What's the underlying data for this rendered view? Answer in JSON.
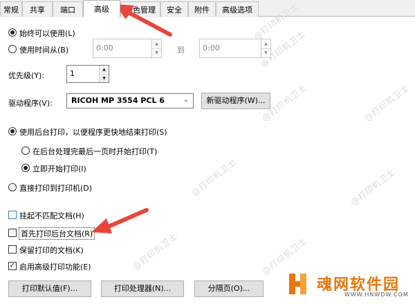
{
  "tabs": [
    "常规",
    "共享",
    "端口",
    "高级",
    "颜色管理",
    "安全",
    "附件",
    "高级选项"
  ],
  "active_tab": "高级",
  "availability": {
    "always_label": "始终可以使用(L)",
    "from_label": "使用时间从(B)",
    "from_time": "0:00",
    "to_label": "到",
    "to_time": "0:00"
  },
  "priority": {
    "label": "优先级(Y):",
    "value": "1"
  },
  "driver": {
    "label": "驱动程序(V):",
    "selected": "RICOH MP 3554 PCL 6",
    "new_button": "新驱动程序(W)..."
  },
  "spool": {
    "spool_label": "使用后台打印，以便程序更快地结束打印(S)",
    "after_last_page": "在后台处理完最后一页时开始打印(T)",
    "immediately": "立即开始打印(I)",
    "direct": "直接打印到打印机(D)"
  },
  "options": {
    "hold_mismatched": "挂起不匹配文档(H)",
    "spooled_first": "首先打印后台文档(R)",
    "keep_printed": "保留打印的文档(K)",
    "advanced_features": "启用高级打印功能(E)"
  },
  "buttons": {
    "defaults": "打印默认值(F)...",
    "processor": "打印处理器(N)...",
    "separator": "分隔页(O)..."
  },
  "watermark": "@打印机卫士",
  "logo": {
    "name": "魂网软件园",
    "url": "WWW.HNWDW.COM"
  },
  "colors": {
    "arrow": "#e8453c",
    "logo_orange": "#e8760f"
  }
}
